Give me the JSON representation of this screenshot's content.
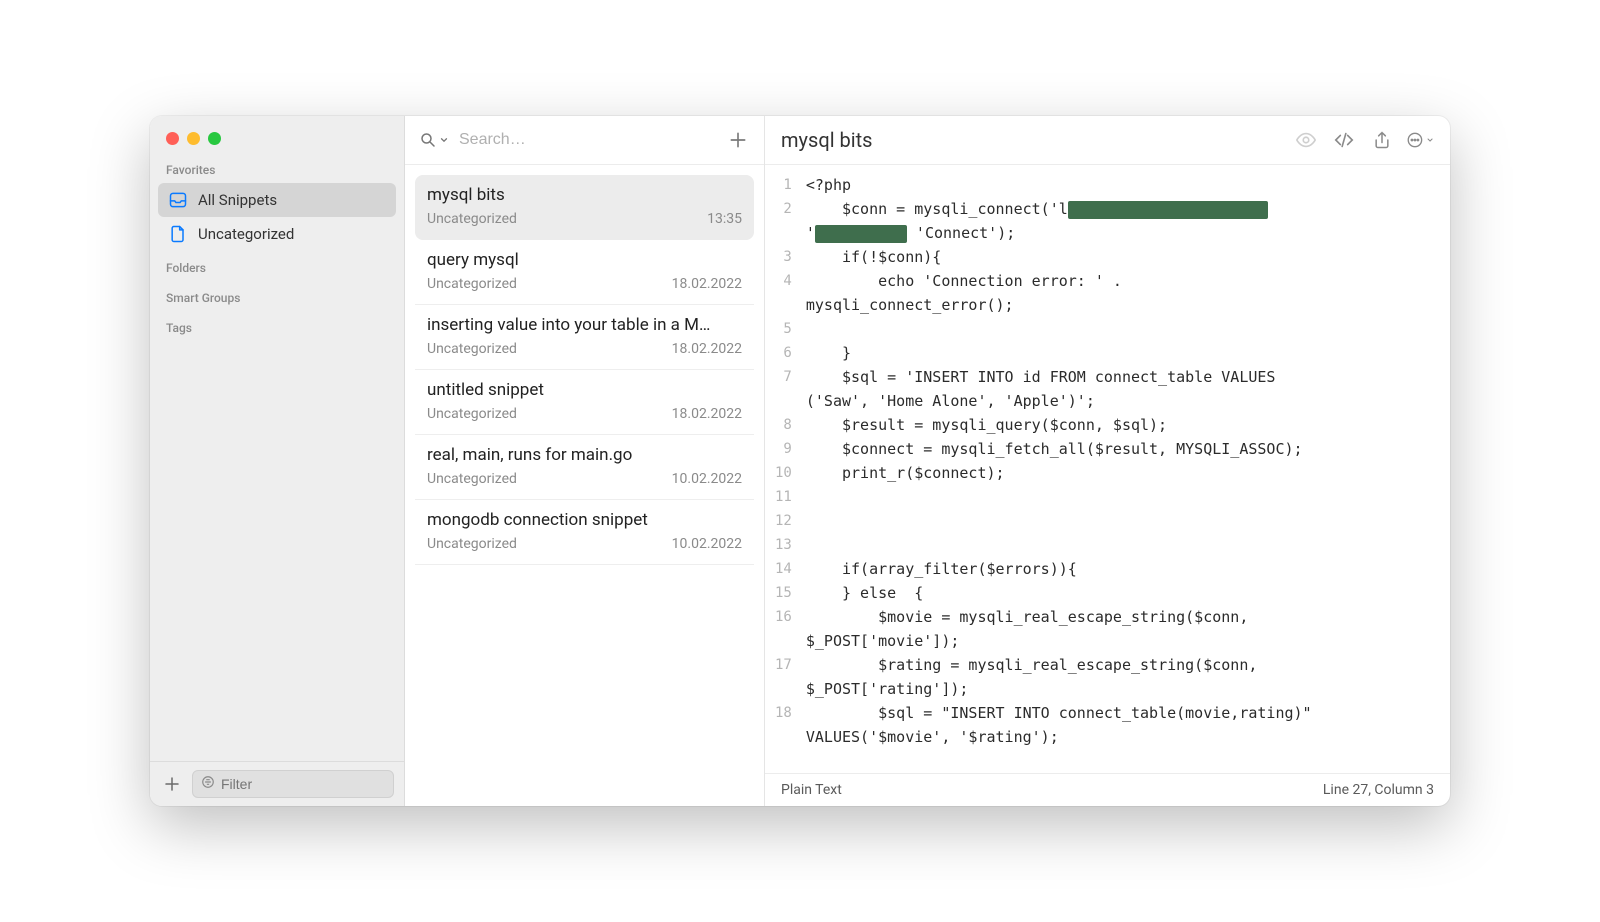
{
  "sidebar": {
    "favorites_header": "Favorites",
    "items": [
      {
        "label": "All Snippets",
        "icon": "tray"
      },
      {
        "label": "Uncategorized",
        "icon": "document"
      }
    ],
    "folders_header": "Folders",
    "smartgroups_header": "Smart Groups",
    "tags_header": "Tags",
    "filter_placeholder": "Filter"
  },
  "list": {
    "search_placeholder": "Search…",
    "items": [
      {
        "title": "mysql bits",
        "category": "Uncategorized",
        "date": "13:35"
      },
      {
        "title": "query mysql",
        "category": "Uncategorized",
        "date": "18.02.2022"
      },
      {
        "title": "inserting value into your table in a M…",
        "category": "Uncategorized",
        "date": "18.02.2022"
      },
      {
        "title": "untitled snippet",
        "category": "Uncategorized",
        "date": "18.02.2022"
      },
      {
        "title": "real, main, runs for main.go",
        "category": "Uncategorized",
        "date": "10.02.2022"
      },
      {
        "title": "mongodb connection snippet",
        "category": "Uncategorized",
        "date": "10.02.2022"
      }
    ]
  },
  "editor": {
    "title": "mysql bits",
    "language": "Plain Text",
    "cursor": "Line 27, Column 3",
    "lines": [
      {
        "n": "1",
        "wrap": 0,
        "text": "<?php"
      },
      {
        "n": "2",
        "wrap": 1,
        "text": "    $conn = mysqli_connect('l",
        "redact1": true,
        "tail_indent": "'",
        "tail_redact2": true,
        "tail_text": " 'Connect');"
      },
      {
        "n": "3",
        "wrap": 0,
        "text": "    if(!$conn){"
      },
      {
        "n": "4",
        "wrap": 1,
        "text": "        echo 'Connection error: ' .",
        "tail_text": "mysqli_connect_error();"
      },
      {
        "n": "5",
        "wrap": 0,
        "text": ""
      },
      {
        "n": "6",
        "wrap": 0,
        "text": "    }"
      },
      {
        "n": "7",
        "wrap": 1,
        "text": "    $sql = 'INSERT INTO id FROM connect_table VALUES",
        "tail_text": "('Saw', 'Home Alone', 'Apple')';"
      },
      {
        "n": "8",
        "wrap": 0,
        "text": "    $result = mysqli_query($conn, $sql);"
      },
      {
        "n": "9",
        "wrap": 0,
        "text": "    $connect = mysqli_fetch_all($result, MYSQLI_ASSOC);"
      },
      {
        "n": "10",
        "wrap": 0,
        "text": "    print_r($connect);"
      },
      {
        "n": "11",
        "wrap": 0,
        "text": ""
      },
      {
        "n": "12",
        "wrap": 0,
        "text": ""
      },
      {
        "n": "13",
        "wrap": 0,
        "text": ""
      },
      {
        "n": "14",
        "wrap": 0,
        "text": "    if(array_filter($errors)){"
      },
      {
        "n": "15",
        "wrap": 0,
        "text": "    } else  {"
      },
      {
        "n": "16",
        "wrap": 1,
        "text": "        $movie = mysqli_real_escape_string($conn,",
        "tail_text": "$_POST['movie']);"
      },
      {
        "n": "17",
        "wrap": 1,
        "text": "        $rating = mysqli_real_escape_string($conn,",
        "tail_text": "$_POST['rating']);"
      },
      {
        "n": "18",
        "wrap": 1,
        "text": "        $sql = \"INSERT INTO connect_table(movie,rating)\"",
        "tail_text": "VALUES('$movie', '$rating');"
      }
    ]
  }
}
